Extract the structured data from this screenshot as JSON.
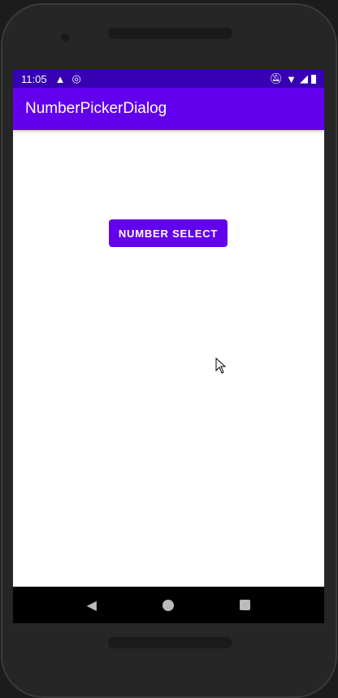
{
  "status_bar": {
    "time": "11:05"
  },
  "app_bar": {
    "title": "NumberPickerDialog"
  },
  "main": {
    "button_label": "NUMBER SELECT"
  },
  "colors": {
    "primary": "#6200ee",
    "primary_dark": "#3700b3"
  }
}
